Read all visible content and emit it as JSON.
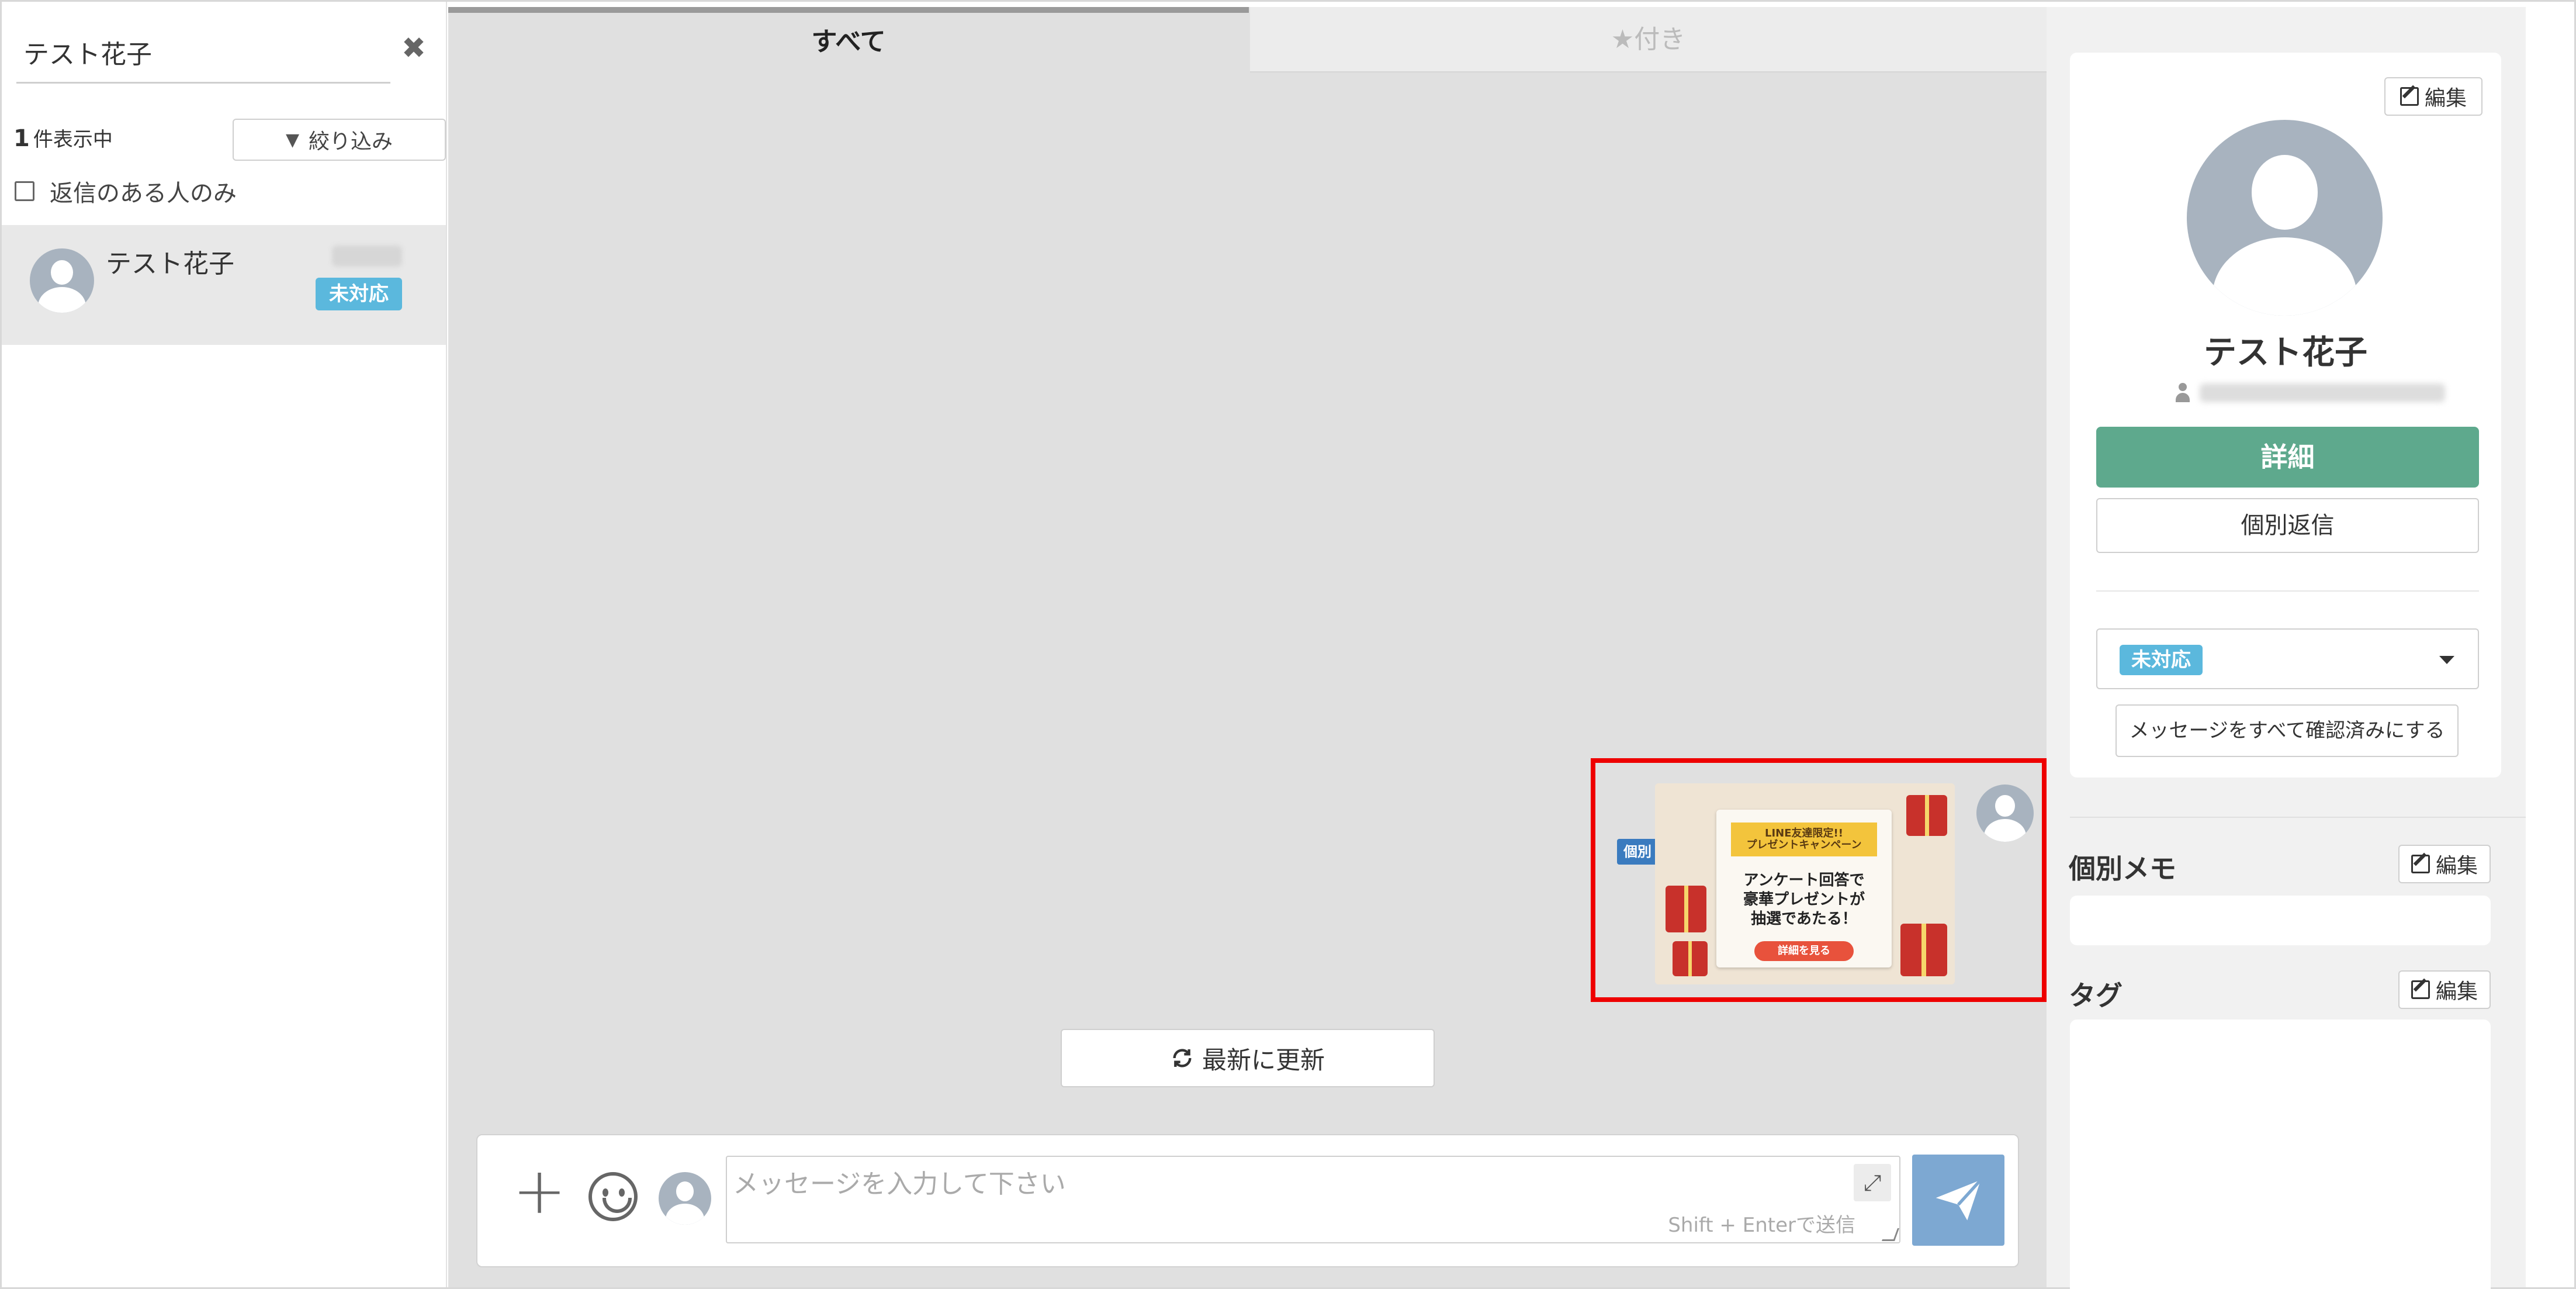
{
  "left": {
    "search_value": "テスト花子",
    "count_number": "1",
    "count_label": "件表示中",
    "filter_label": "絞り込み",
    "reply_only_label": "返信のある人のみ",
    "contacts": [
      {
        "name": "テスト花子",
        "status": "未対応"
      }
    ]
  },
  "center": {
    "tabs": [
      {
        "label": "すべて",
        "active": true
      },
      {
        "label": "★付き",
        "active": false
      }
    ],
    "message": {
      "type_badge": "個別",
      "image": {
        "ribbon_line1": "LINE友達限定!!",
        "ribbon_line2": "プレゼントキャンペーン",
        "main_line1": "アンケート回答で",
        "main_line2": "豪華プレゼントが",
        "main_line3": "抽選であたる！",
        "button": "詳細を見る"
      }
    },
    "refresh_label": "最新に更新",
    "composer": {
      "placeholder": "メッセージを入力して下さい",
      "hint": "Shift + Enterで送信"
    }
  },
  "right": {
    "edit_label": "編集",
    "profile_name": "テスト花子",
    "detail_label": "詳細",
    "individual_reply_label": "個別返信",
    "status_value": "未対応",
    "mark_all_read_label": "メッセージをすべて確認済みにする",
    "memo_title": "個別メモ",
    "tag_title": "タグ"
  },
  "colors": {
    "status_badge": "#5bb8dd",
    "detail_button": "#5ea98d",
    "send_button": "#7da8d2",
    "highlight_border": "#ee0000",
    "individual_badge": "#3a7bbf"
  },
  "icons": [
    "close-icon",
    "filter-icon",
    "avatar-icon",
    "refresh-icon",
    "plus-icon",
    "emoji-icon",
    "expand-icon",
    "send-icon",
    "edit-icon",
    "user-icon",
    "caret-down-icon"
  ]
}
